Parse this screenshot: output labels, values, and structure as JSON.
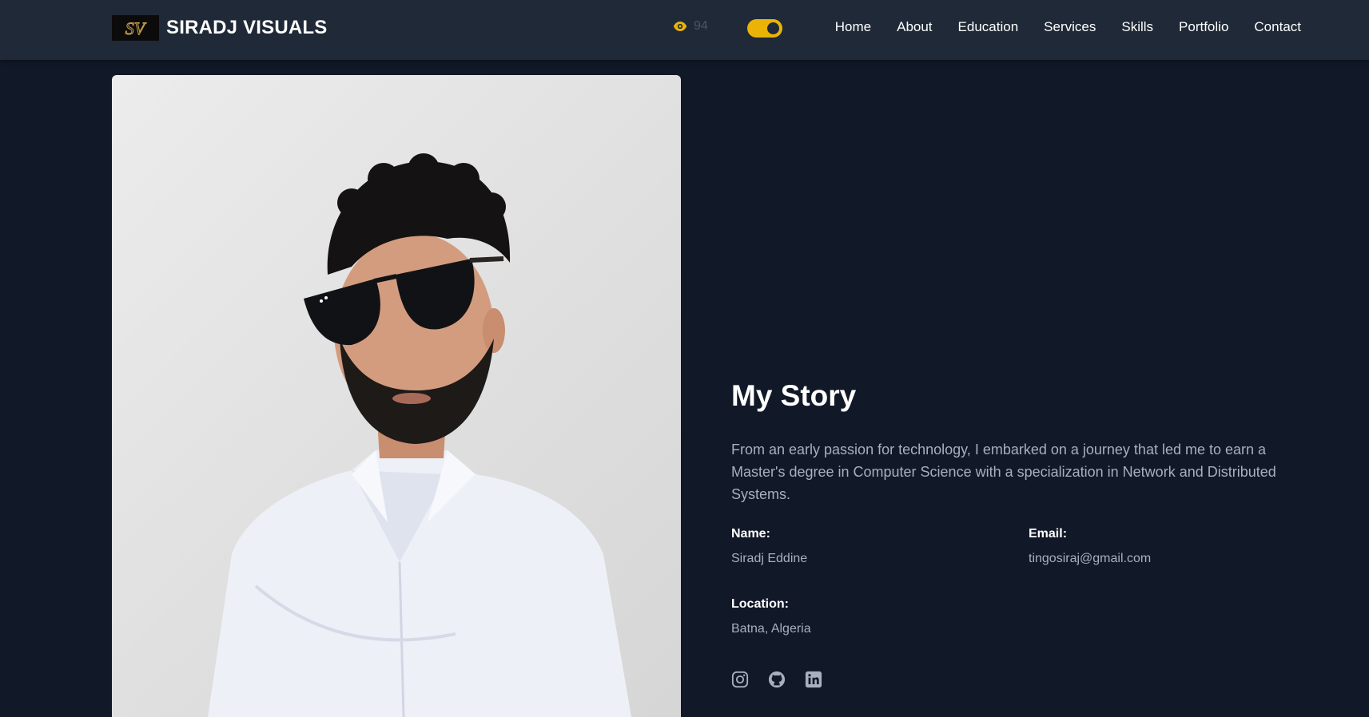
{
  "brand": {
    "name": "SIRADJ VISUALS",
    "logo_text": "SV"
  },
  "header": {
    "view_count": "94",
    "theme_toggle": "on"
  },
  "nav": {
    "items": [
      {
        "label": "Home"
      },
      {
        "label": "About"
      },
      {
        "label": "Education"
      },
      {
        "label": "Services"
      },
      {
        "label": "Skills"
      },
      {
        "label": "Portfolio"
      },
      {
        "label": "Contact"
      }
    ]
  },
  "story": {
    "title": "My Story",
    "text": "From an early passion for technology, I embarked on a journey that led me to earn a Master's degree in Computer Science with a specialization in Network and Distributed Systems."
  },
  "info": {
    "name_label": "Name:",
    "name_value": "Siradj Eddine",
    "email_label": "Email:",
    "email_value": "tingosiraj@gmail.com",
    "location_label": "Location:",
    "location_value": "Batna, Algeria"
  },
  "socials": [
    "instagram-icon",
    "github-icon",
    "linkedin-icon"
  ],
  "colors": {
    "background": "#111827",
    "navbar": "#1f2937",
    "accent": "#eab308",
    "muted_text": "#a7b0bf"
  }
}
